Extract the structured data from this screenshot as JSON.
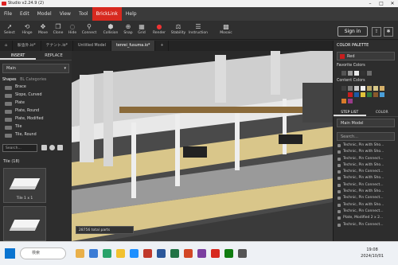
{
  "window": {
    "title": "Studio v2.24.9 (2)"
  },
  "menu": [
    "File",
    "Edit",
    "Model",
    "View",
    "Tool",
    "BrickLink",
    "Help"
  ],
  "toolbar": {
    "tools": [
      "Select",
      "Hinge",
      "Move",
      "Clone",
      "Hide",
      "Connect",
      "Collision",
      "Snap",
      "Grid",
      "Render",
      "Stability",
      "Instruction",
      "Mosaic"
    ],
    "signin": "Sign in"
  },
  "tabs": [
    "駅舎外.io*",
    "テナント.io*",
    "Untitled Model",
    "tenrei_fusuma.io*"
  ],
  "left": {
    "insert_tab": "INSERT",
    "replace_tab": "REPLACE",
    "palette_select": "Main",
    "shapes_label": "Shapes",
    "all_categories": "BL Categories",
    "categories": [
      "Brace",
      "Slope, Curved",
      "Plate",
      "Plate, Round",
      "Plate, Modified",
      "Tile",
      "Tile, Round"
    ],
    "search_placeholder": "Search...",
    "tile_title": "Tile (18)",
    "tile_label": "Tile 1 x 1"
  },
  "viewport": {
    "parts_count": "28756 total parts"
  },
  "right": {
    "palette_title": "COLOR PALETTE",
    "selected_color": "Red",
    "favorite_colors": "Favorite Colors",
    "content_colors": "Content Colors",
    "step_list_tab": "STEP LIST",
    "color_validator_tab": "COLOR VALIDATOR",
    "model_select": "Main Model",
    "search_placeholder": "Search...",
    "steps": [
      "Technic, Pin with Sho...",
      "Technic, Pin with Sho...",
      "Technic, Pin Connect...",
      "Technic, Pin with Sho...",
      "Technic, Pin Connect...",
      "Technic, Pin with Sho...",
      "Technic, Pin Connect...",
      "Technic, Pin with Sho...",
      "Technic, Pin Connect...",
      "Technic, Pin with Sho...",
      "Technic, Pin Connect...",
      "Plate, Modified 2 x 2...",
      "Technic, Pin Connect..."
    ]
  },
  "colors": {
    "favorites": [
      "#555555",
      "#9a9a9a",
      "#e9e9e9",
      "#333333",
      "#6b6b6b"
    ],
    "content": [
      "#3e3e3e",
      "#7a7a7a",
      "#c9c9c9",
      "#f2f2f2",
      "#bfa86a",
      "#d9c98a",
      "#d5b06a",
      "#2c2c2c",
      "#c81d1d",
      "#1f5aa6",
      "#e1c33a",
      "#2f7d3f",
      "#8a5a2b",
      "#4a9ed8",
      "#d97b2a",
      "#9a3b8a"
    ]
  },
  "taskbar": {
    "search_placeholder": "検索",
    "time": "19:08",
    "date": "2024/10/01"
  }
}
